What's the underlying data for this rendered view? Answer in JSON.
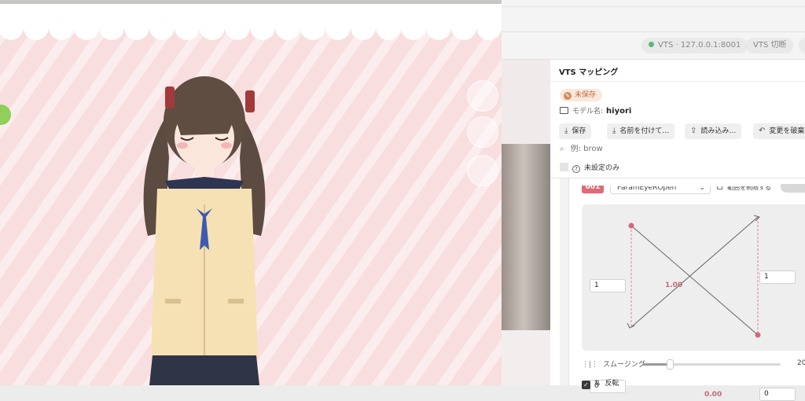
{
  "header": {
    "connection_chip": "VTS · 127.0.0.1:8001",
    "disconnect_chip": "VTS 切断"
  },
  "panel": {
    "title": "VTS マッピング",
    "unsaved_badge": "未保存",
    "model_label": "モデル名:",
    "model_value": "hiyori",
    "buttons": {
      "save": "保存",
      "save_as": "名前を付けて…",
      "load": "読み込み…",
      "discard": "変更を破棄"
    },
    "search_placeholder": "例: brow",
    "filter_unset_only": "未設定のみ"
  },
  "mapping_item": {
    "index": "001",
    "parameter": "ParamEyeROpen",
    "limit_range_label": "範囲を制限する",
    "input_max": "1",
    "input_min": "0",
    "output_max": "1",
    "output_min": "0",
    "current_top_value": "1.00",
    "current_bottom_value": "0.00",
    "smoothing_label": "スムージング",
    "smoothing_value": "20",
    "smoothing_level": 0.2,
    "invert_label": "反転",
    "invert_checked": true
  },
  "colors": {
    "accent_pink": "#e06a75",
    "graph_point": "#d6677a",
    "status_green": "#5bb67a",
    "unsaved_bg": "#fbe8dc"
  },
  "icons": {
    "save": "save-icon",
    "save_as": "save-as-icon",
    "load": "upload-icon",
    "discard": "undo-icon",
    "search": "search-icon",
    "help": "question-icon",
    "smoothing": "smoothing-icon",
    "invert": "swap-vertical-icon"
  }
}
